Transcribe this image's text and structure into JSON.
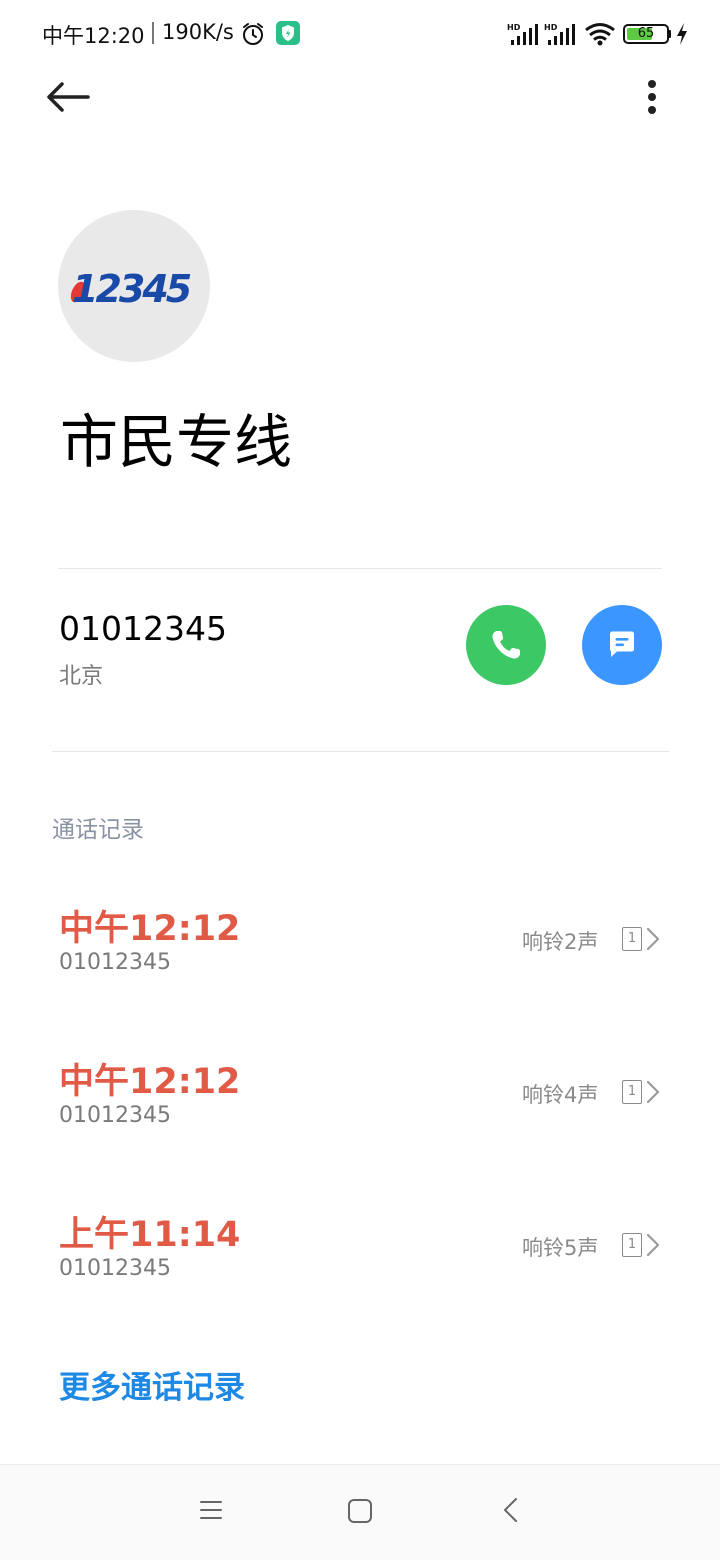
{
  "status_bar": {
    "time": "中午12:20",
    "speed": "190K/s",
    "battery": "65",
    "battery_level": 0.65,
    "icons": [
      "alarm-icon",
      "shield-icon",
      "hd-signal-icon",
      "hd-signal-icon",
      "wifi-icon",
      "battery-icon",
      "charging-bolt-icon"
    ]
  },
  "toolbar": {
    "back_icon": "arrow-left-icon",
    "more_icon": "more-vertical-icon"
  },
  "contact": {
    "avatar_text": "12345",
    "name": "市民专线",
    "number": "01012345",
    "location": "北京"
  },
  "actions": {
    "call_icon": "phone-icon",
    "message_icon": "message-icon"
  },
  "history": {
    "title": "通话记录",
    "items": [
      {
        "time": "中午12:12",
        "number": "01012345",
        "rings": "响铃2声",
        "sim": "1"
      },
      {
        "time": "中午12:12",
        "number": "01012345",
        "rings": "响铃4声",
        "sim": "1"
      },
      {
        "time": "上午11:14",
        "number": "01012345",
        "rings": "响铃5声",
        "sim": "1"
      }
    ],
    "more_label": "更多通话记录"
  },
  "colors": {
    "missed_call": "#e05a45",
    "call_green": "#3cc864",
    "message_blue": "#3b96ff",
    "link_blue": "#1e88e5"
  }
}
